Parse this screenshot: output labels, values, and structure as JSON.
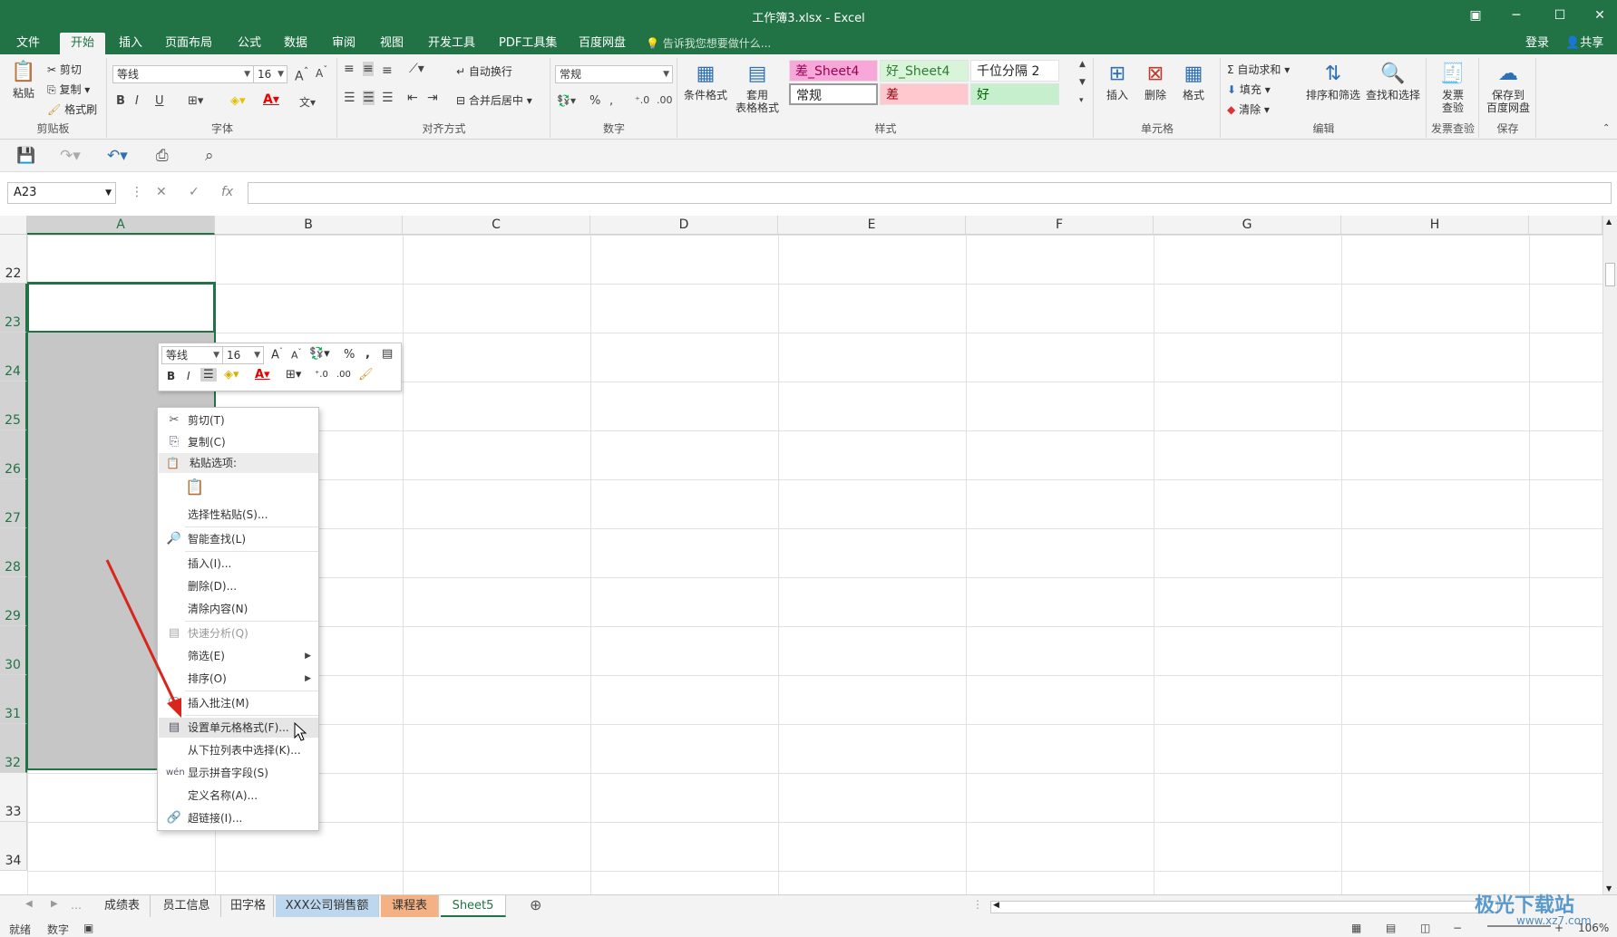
{
  "window": {
    "title": "工作簿3.xlsx - Excel"
  },
  "ribbon_tabs": [
    "文件",
    "开始",
    "插入",
    "页面布局",
    "公式",
    "数据",
    "审阅",
    "视图",
    "开发工具",
    "PDF工具集",
    "百度网盘"
  ],
  "active_tab": "开始",
  "tell_me": "告诉我您想要做什么...",
  "account": {
    "login": "登录",
    "share": "共享"
  },
  "clipboard": {
    "paste": "粘贴",
    "cut": "剪切",
    "copy": "复制",
    "format_painter": "格式刷",
    "label": "剪贴板"
  },
  "font": {
    "name": "等线",
    "size": "16",
    "label": "字体"
  },
  "alignment": {
    "wrap": "自动换行",
    "merge": "合并后居中",
    "label": "对齐方式"
  },
  "number": {
    "format": "常规",
    "label": "数字"
  },
  "styles": {
    "conditional": "条件格式",
    "table_format": "套用\n表格格式",
    "label": "样式",
    "boxes": [
      {
        "text": "差_Sheet4",
        "bg": "#f7a8d8",
        "color": "#9c0057"
      },
      {
        "text": "好_Sheet4",
        "bg": "#d9f5d9",
        "color": "#2e7d32"
      },
      {
        "text": "千位分隔 2",
        "bg": "#ffffff",
        "color": "#222222"
      },
      {
        "text": "常规",
        "bg": "#ffffff",
        "color": "#222222"
      },
      {
        "text": "差",
        "bg": "#ffc7ce",
        "color": "#9c0006"
      },
      {
        "text": "好",
        "bg": "#c6efce",
        "color": "#006100"
      }
    ]
  },
  "cells_group": {
    "insert": "插入",
    "delete": "删除",
    "format": "格式",
    "label": "单元格"
  },
  "editing": {
    "autosum": "自动求和",
    "fill": "填充",
    "clear": "清除",
    "sort": "排序和筛选",
    "find": "查找和选择",
    "label": "编辑"
  },
  "invoice": {
    "check": "发票\n查验",
    "label": "发票查验"
  },
  "save_baidu": {
    "btn": "保存到\n百度网盘",
    "label": "保存"
  },
  "name_box": "A23",
  "columns": [
    "A",
    "B",
    "C",
    "D",
    "E",
    "F",
    "G",
    "H"
  ],
  "rows": [
    "22",
    "23",
    "24",
    "25",
    "26",
    "27",
    "28",
    "29",
    "30",
    "31",
    "32",
    "33",
    "34"
  ],
  "mini_toolbar": {
    "font": "等线",
    "size": "16"
  },
  "context_menu": {
    "cut": "剪切(T)",
    "copy": "复制(C)",
    "paste_options": "粘贴选项:",
    "paste_special": "选择性粘贴(S)...",
    "smart_lookup": "智能查找(L)",
    "insert": "插入(I)...",
    "delete": "删除(D)...",
    "clear": "清除内容(N)",
    "quick_analysis": "快速分析(Q)",
    "filter": "筛选(E)",
    "sort": "排序(O)",
    "comment": "插入批注(M)",
    "format_cells": "设置单元格格式(F)...",
    "dropdown": "从下拉列表中选择(K)...",
    "phonetic": "显示拼音字段(S)",
    "define_name": "定义名称(A)...",
    "hyperlink": "超链接(I)..."
  },
  "sheet_tabs": [
    {
      "name": "成绩表",
      "color": ""
    },
    {
      "name": "员工信息",
      "color": ""
    },
    {
      "name": "田字格",
      "color": ""
    },
    {
      "name": "XXX公司销售额",
      "color": "#bdd7ee"
    },
    {
      "name": "课程表",
      "color": "#f4b183"
    },
    {
      "name": "Sheet5",
      "color": "",
      "active": true
    }
  ],
  "status": {
    "ready": "就绪",
    "mode": "数字",
    "zoom": "106%"
  },
  "watermark": {
    "brand": "极光下载站",
    "url": "www.xz7.com"
  },
  "colors": {
    "excel_green": "#217346",
    "arrow_red": "#d9261c"
  }
}
